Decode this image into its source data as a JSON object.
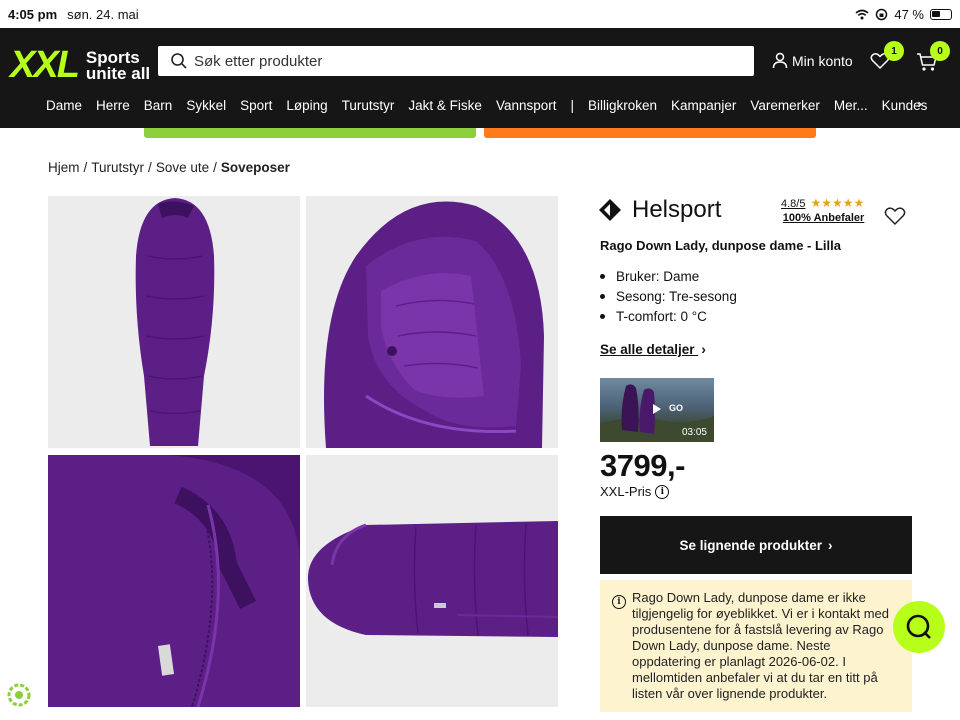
{
  "statusbar": {
    "time": "4:05 pm",
    "date": "søn. 24. mai",
    "battery": "47 %"
  },
  "logo": {
    "brand": "XXL",
    "tagline_1": "Sports",
    "tagline_2": "unite all"
  },
  "search": {
    "placeholder": "Søk etter produkter"
  },
  "account": {
    "label": "Min konto"
  },
  "wishlist": {
    "count": "1"
  },
  "cart": {
    "count": "0"
  },
  "nav": {
    "items": [
      "Dame",
      "Herre",
      "Barn",
      "Sykkel",
      "Sport",
      "Løping",
      "Turutstyr",
      "Jakt & Fiske",
      "Vannsport"
    ],
    "separator": "|",
    "items2": [
      "Billigkroken",
      "Kampanjer",
      "Varemerker",
      "Mer...",
      "Kundes"
    ]
  },
  "breadcrumb": {
    "items": [
      "Hjem",
      "Turutstyr",
      "Sove ute"
    ],
    "separator": "/",
    "current": "Soveposer"
  },
  "product": {
    "brand": "Helsport",
    "rating": "4.8/5",
    "stars": "★★★★★",
    "recommend": "100% Anbefaler",
    "title": "Rago Down Lady, dunpose dame - Lilla",
    "features": [
      "Bruker: Dame",
      "Sesong: Tre-sesong",
      "T-comfort: 0 °C"
    ],
    "details_link": "Se alle detaljer",
    "video": {
      "label": "GO",
      "duration": "03:05"
    },
    "price": "3799,-",
    "price_label": "XXL-Pris",
    "similar_button": "Se lignende produkter",
    "notice": "Rago Down Lady, dunpose dame er ikke tilgjengelig for øyeblikket. Vi er i kontakt med produsentene for å fastslå levering av Rago Down Lady, dunpose dame. Neste oppdatering er planlagt 2026-06-02. I mellomtiden anbefaler vi at du tar en titt på listen vår over lignende produkter."
  },
  "colors": {
    "accent": "#b7ff1a",
    "header_bg": "#161616",
    "product_purple": "#5c1f86",
    "notice_bg": "#fdf3cf"
  }
}
